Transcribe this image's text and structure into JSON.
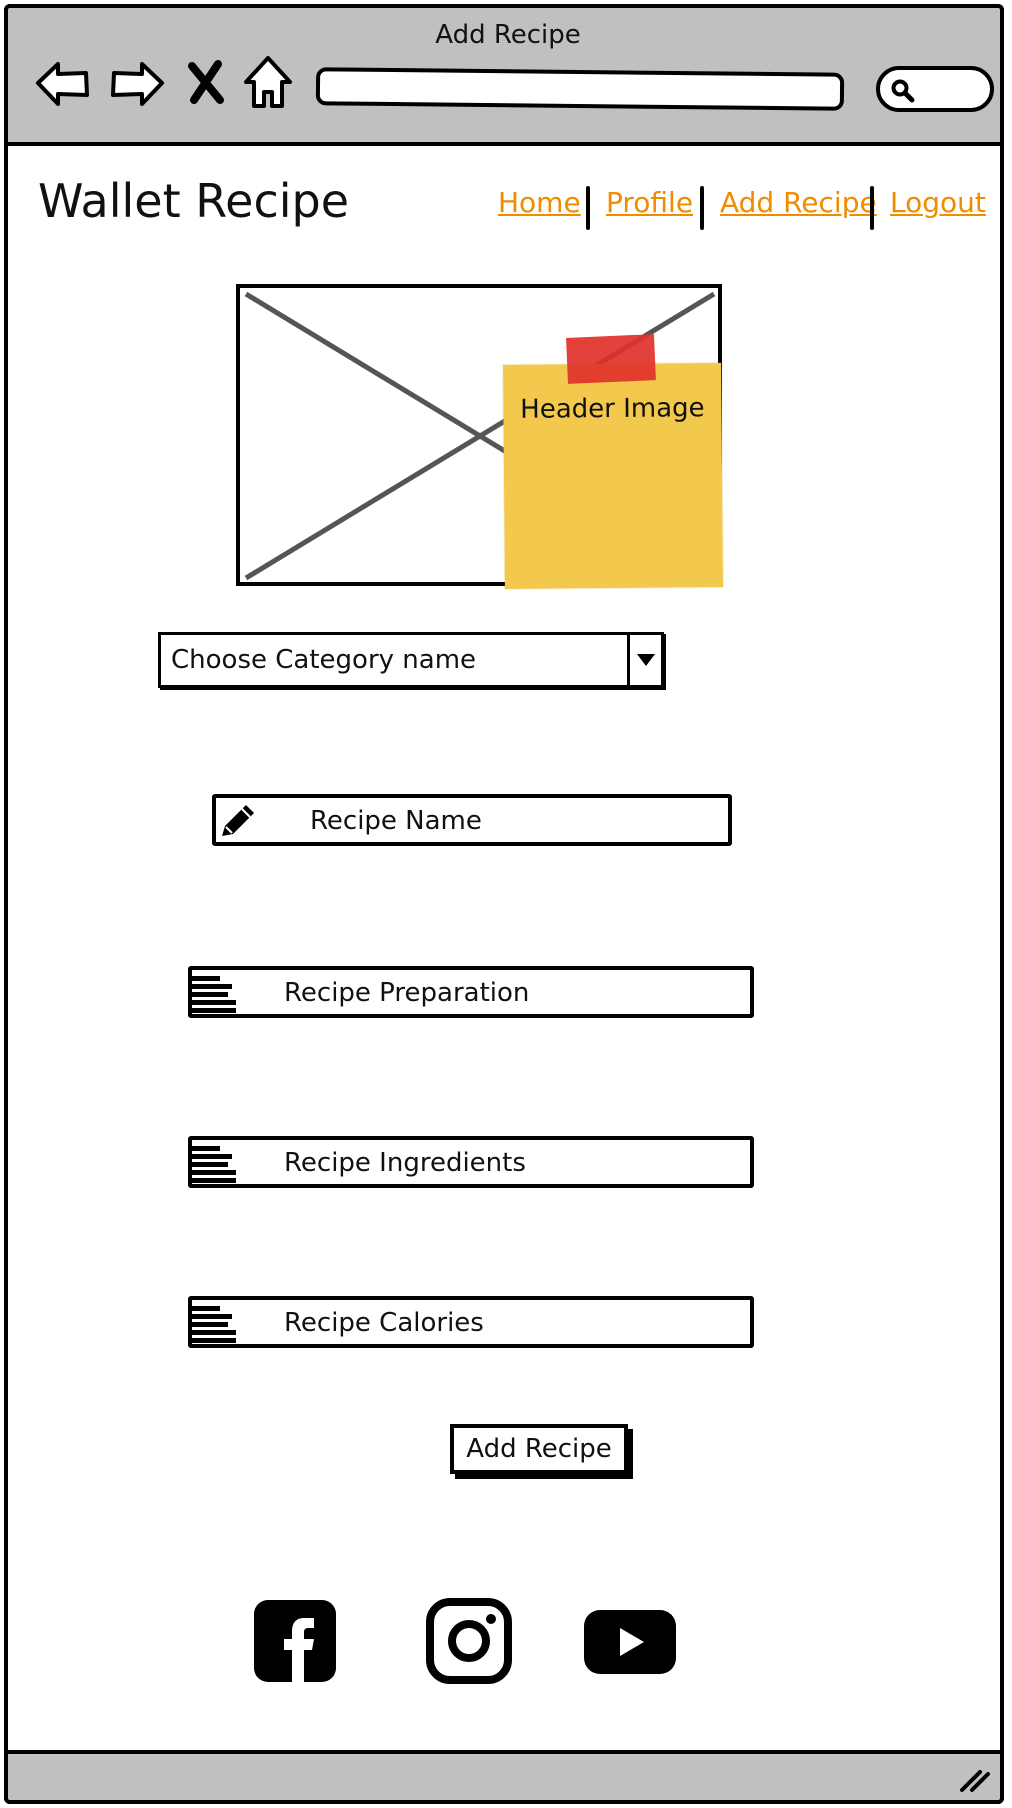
{
  "window": {
    "title": "Add Recipe"
  },
  "browser": {
    "back_icon": "back-arrow-icon",
    "forward_icon": "forward-arrow-icon",
    "stop_icon": "close-icon",
    "home_icon": "home-icon",
    "search_icon": "search-icon",
    "url_value": ""
  },
  "header": {
    "app_title": "Wallet Recipe",
    "menu": [
      {
        "label": "Home"
      },
      {
        "label": "Profile"
      },
      {
        "label": "Add Recipe"
      },
      {
        "label": "Logout"
      }
    ],
    "link_color": "#f08c00"
  },
  "main": {
    "header_image": {
      "note": "Header Image",
      "note_color": "#f2c94c",
      "tape_color": "#e0322a"
    },
    "category_select": {
      "selected": "Choose Category name"
    },
    "fields": [
      {
        "placeholder": "Recipe Name",
        "icon": "pencil-icon"
      },
      {
        "placeholder": "Recipe Preparation",
        "icon": "text-lines-icon"
      },
      {
        "placeholder": "Recipe Ingredients",
        "icon": "text-lines-icon"
      },
      {
        "placeholder": "Recipe Calories",
        "icon": "text-lines-icon"
      }
    ],
    "submit_label": "Add Recipe"
  },
  "footer": {
    "social": [
      {
        "icon": "facebook-icon"
      },
      {
        "icon": "instagram-icon"
      },
      {
        "icon": "youtube-icon"
      }
    ]
  },
  "colors": {
    "chrome": "#c0c0c0",
    "border": "#000000"
  }
}
